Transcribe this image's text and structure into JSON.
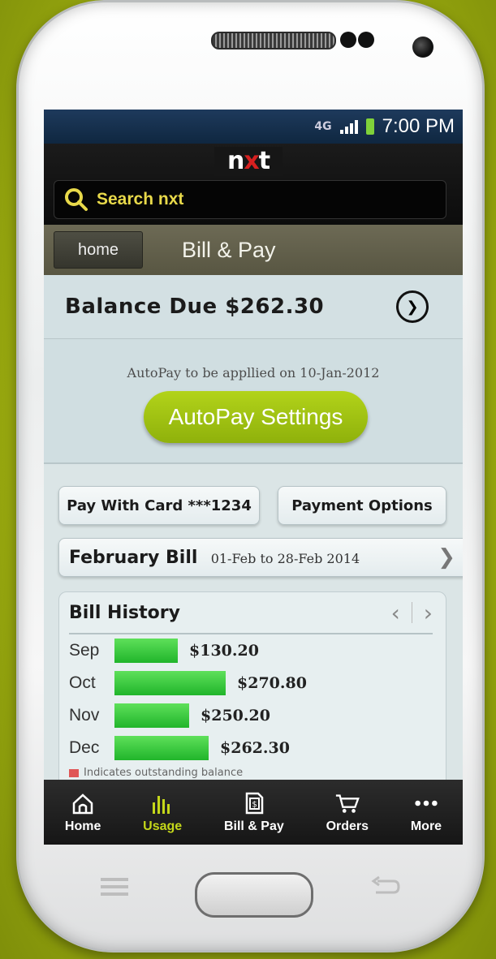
{
  "status_bar": {
    "network": "4G",
    "time": "7:00 PM"
  },
  "brand": {
    "logo_text": "nxt"
  },
  "search": {
    "placeholder": "Search nxt"
  },
  "nav": {
    "home_label": "home",
    "title": "Bill & Pay"
  },
  "balance": {
    "text": "Balance Due $262.30"
  },
  "autopay": {
    "note": "AutoPay to be appllied on 10-Jan-2012",
    "button_label": "AutoPay Settings"
  },
  "payment": {
    "card_label": "Pay With Card ***1234",
    "options_label": "Payment Options"
  },
  "bill": {
    "title": "February Bill",
    "range": "01-Feb to 28-Feb 2014"
  },
  "history": {
    "title": "Bill History",
    "rows": [
      {
        "month": "Sep",
        "amount": "$130.20",
        "fill": 0.37
      },
      {
        "month": "Oct",
        "amount": "$270.80",
        "fill": 0.65
      },
      {
        "month": "Nov",
        "amount": "$250.20",
        "fill": 0.44
      },
      {
        "month": "Dec",
        "amount": "$262.30",
        "fill": 0.55
      }
    ],
    "legend": "Indicates outstanding balance"
  },
  "tabs": [
    {
      "label": "Home",
      "icon": "home-icon",
      "active": false
    },
    {
      "label": "Usage",
      "icon": "bar-chart-icon",
      "active": true
    },
    {
      "label": "Bill & Pay",
      "icon": "bill-icon",
      "active": false
    },
    {
      "label": "Orders",
      "icon": "cart-icon",
      "active": false
    },
    {
      "label": "More",
      "icon": "more-icon",
      "active": false
    }
  ],
  "colors": {
    "accent": "#9fc212",
    "active_tab": "#c4d71a",
    "bar": "#3ccd3f"
  }
}
